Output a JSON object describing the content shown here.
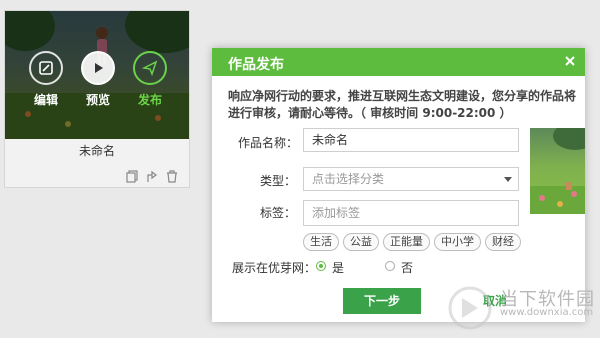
{
  "card": {
    "actions": [
      {
        "label": "编辑",
        "icon": "edit-icon"
      },
      {
        "label": "预览",
        "icon": "play-icon"
      },
      {
        "label": "发布",
        "icon": "send-icon"
      }
    ],
    "title": "未命名",
    "tools": [
      "copy-icon",
      "share-icon",
      "trash-icon"
    ]
  },
  "dialog": {
    "title": "作品发布",
    "close": "×",
    "notice": "响应净网行动的要求，推进互联网生态文明建设，您分享的作品将进行审核，请耐心等待。（ 审核时间 9:00-22:00 ）",
    "name_label": "作品名称：",
    "name_value": "未命名",
    "type_label": "类型：",
    "type_placeholder": "点击选择分类",
    "tags_label": "标签：",
    "tags_placeholder": "添加标签",
    "tags": [
      "生活",
      "公益",
      "正能量",
      "中小学",
      "财经"
    ],
    "showcase_label": "展示在优芽网：",
    "radio_yes": "是",
    "radio_no": "否",
    "next_button": "下一步",
    "cancel_button": "取消"
  },
  "watermark": {
    "text": "当下软件园",
    "url": "www.downxia.com"
  },
  "colors": {
    "accent": "#5dbb3e",
    "button": "#3aa34a"
  }
}
